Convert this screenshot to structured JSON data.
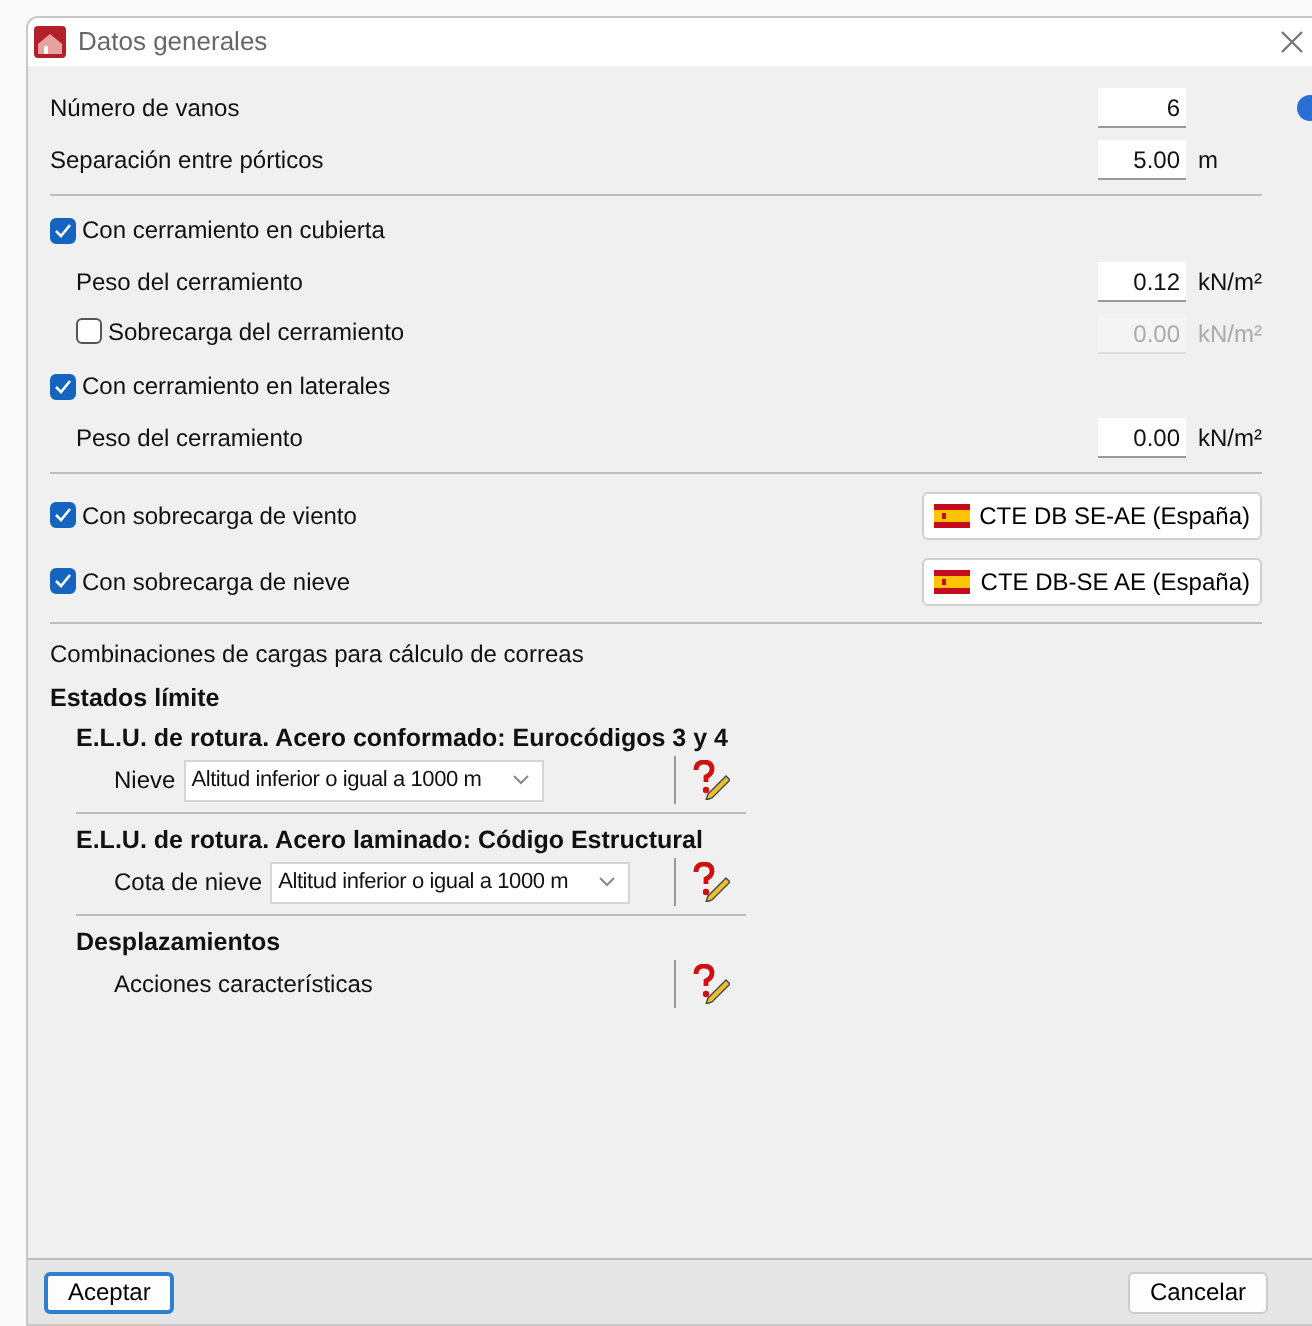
{
  "window": {
    "title": "Datos generales"
  },
  "general": [
    {
      "label": "Número de vanos",
      "value": "6",
      "disabled": false
    },
    {
      "label": "Separación entre pórticos",
      "value": "5.00",
      "unit": "m",
      "disabled": false
    }
  ],
  "enclosure": [
    {
      "kind": "check",
      "label": "Con cerramiento en cubierta",
      "checked": true
    },
    {
      "kind": "field",
      "label": "Peso del cerramiento",
      "value": "0.12",
      "unit": "kN/m²",
      "disabled": false
    },
    {
      "kind": "checkfield",
      "label": "Sobrecarga del cerramiento",
      "checked": false,
      "value": "0.00",
      "unit": "kN/m²",
      "disabled": true
    },
    {
      "kind": "check",
      "label": "Con cerramiento en laterales",
      "checked": true
    },
    {
      "kind": "field",
      "label": "Peso del cerramiento",
      "value": "0.00",
      "unit": "kN/m²",
      "disabled": false
    }
  ],
  "loads": [
    {
      "label": "Con sobrecarga de viento",
      "checked": true,
      "standard": "CTE DB SE-AE (España)"
    },
    {
      "label": "Con sobrecarga de nieve",
      "checked": true,
      "standard": "CTE DB-SE AE (España)"
    }
  ],
  "combinations": {
    "title": "Combinaciones de cargas para cálculo de correas",
    "heading": "Estados límite",
    "groups": [
      {
        "kind": "select",
        "title": "E.L.U. de rotura. Acero conformado: Eurocódigos 3 y 4",
        "label": "Nieve",
        "value": "Altitud inferior o igual a 1000 m"
      },
      {
        "kind": "select",
        "title": "E.L.U. de rotura. Acero laminado: Código Estructural",
        "label": "Cota de nieve",
        "value": "Altitud inferior o igual a 1000 m"
      },
      {
        "kind": "text",
        "title": "Desplazamientos",
        "label": "Acciones características"
      }
    ]
  },
  "buttons": {
    "ok": "Aceptar",
    "cancel": "Cancelar"
  }
}
